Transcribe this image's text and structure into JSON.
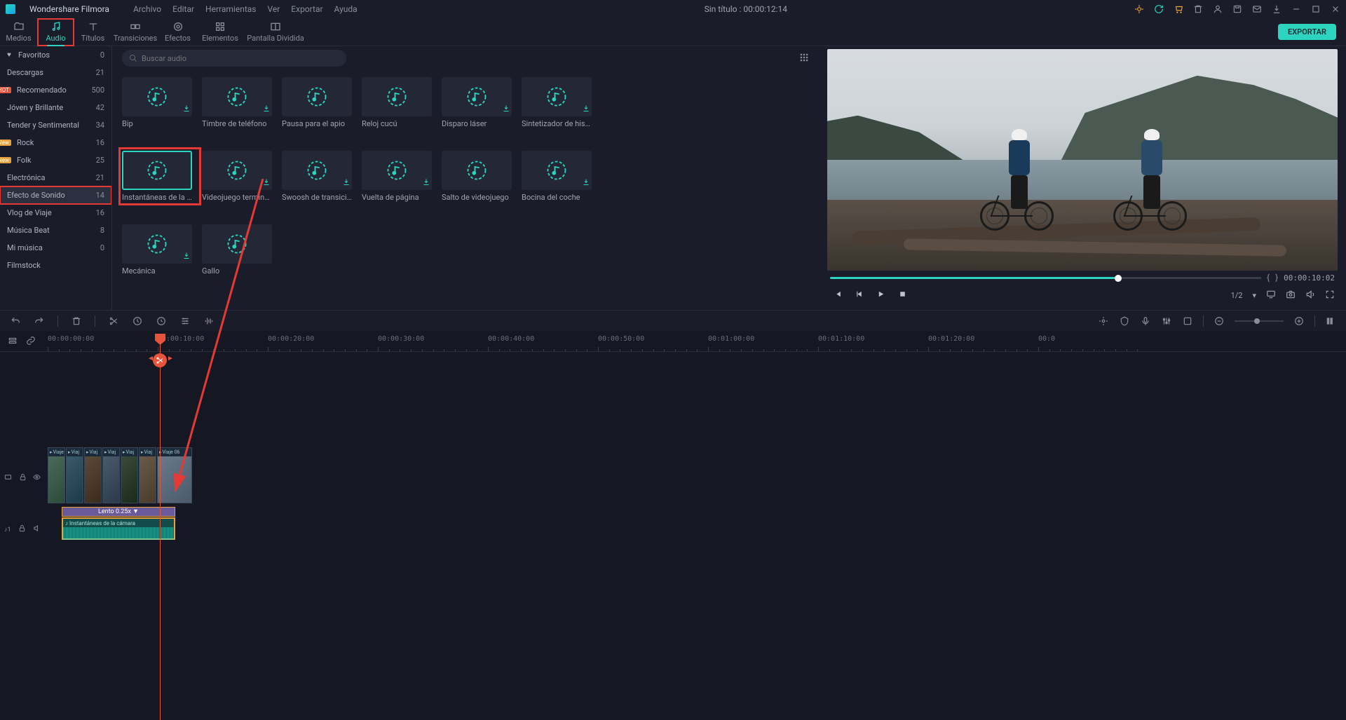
{
  "titlebar": {
    "app_name": "Wondershare Filmora",
    "menus": [
      "Archivo",
      "Editar",
      "Herramientas",
      "Ver",
      "Exportar",
      "Ayuda"
    ],
    "document_title": "Sin título : 00:00:12:14"
  },
  "toolbar": {
    "tabs": [
      {
        "label": "Medios",
        "icon": "folder"
      },
      {
        "label": "Audio",
        "icon": "music",
        "active": true,
        "highlight": true
      },
      {
        "label": "Títulos",
        "icon": "text"
      },
      {
        "label": "Transiciones",
        "icon": "transition"
      },
      {
        "label": "Efectos",
        "icon": "effects"
      },
      {
        "label": "Elementos",
        "icon": "elements"
      },
      {
        "label": "Pantalla Dividida",
        "icon": "split"
      }
    ],
    "export_label": "EXPORTAR"
  },
  "sidebar": {
    "items": [
      {
        "label": "Favoritos",
        "count": 0,
        "heart": true
      },
      {
        "label": "Descargas",
        "count": 21
      },
      {
        "label": "Recomendado",
        "count": 500,
        "badge": "HOT"
      },
      {
        "label": "Jóven y Brillante",
        "count": 42
      },
      {
        "label": "Tender y Sentimental",
        "count": 34
      },
      {
        "label": "Rock",
        "count": 16,
        "badge": "New"
      },
      {
        "label": "Folk",
        "count": 25,
        "badge": "New"
      },
      {
        "label": "Electrónica",
        "count": 21
      },
      {
        "label": "Efecto de Sonido",
        "count": 14,
        "highlight": true
      },
      {
        "label": "Vlog de Viaje",
        "count": 16
      },
      {
        "label": "Música Beat",
        "count": 8
      },
      {
        "label": "Mi música",
        "count": 0
      },
      {
        "label": "Filmstock",
        "count": ""
      }
    ]
  },
  "search": {
    "placeholder": "Buscar audio"
  },
  "assets": [
    {
      "label": "Bip",
      "dl": true
    },
    {
      "label": "Timbre de teléfono",
      "dl": true
    },
    {
      "label": "Pausa para el apio"
    },
    {
      "label": "Reloj cucú"
    },
    {
      "label": "Disparo láser",
      "dl": true
    },
    {
      "label": "Sintetizador de histor…",
      "dl": true
    },
    {
      "label": "Instantáneas de la cá…",
      "selected": true,
      "highlight": true
    },
    {
      "label": "Videojuego terminado",
      "dl": true
    },
    {
      "label": "Swoosh de transición",
      "dl": true
    },
    {
      "label": "Vuelta de página",
      "dl": true
    },
    {
      "label": "Salto de videojuego"
    },
    {
      "label": "Bocina del coche",
      "dl": true
    },
    {
      "label": "Mecánica",
      "dl": true
    },
    {
      "label": "Gallo"
    }
  ],
  "preview": {
    "timecode_end": "00:00:10:02",
    "page": "1/2"
  },
  "ruler": {
    "marks": [
      "00:00:00:00",
      "00:00:10:00",
      "00:00:20:00",
      "00:00:30:00",
      "00:00:40:00",
      "00:00:50:00",
      "00:01:00:00",
      "00:01:10:00",
      "00:01:20:00",
      "00:0"
    ]
  },
  "video_clips": [
    {
      "label": "Viaje"
    },
    {
      "label": "Viaj"
    },
    {
      "label": "Viaj"
    },
    {
      "label": "Viaj"
    },
    {
      "label": "Viaj"
    },
    {
      "label": "Viaj"
    },
    {
      "label": "Viaje 06"
    }
  ],
  "speed_label": "Lento 0.25x ▼",
  "audio_clip_label": "Instantáneas de la cámara",
  "track_labels": {
    "video": "",
    "audio": ""
  }
}
